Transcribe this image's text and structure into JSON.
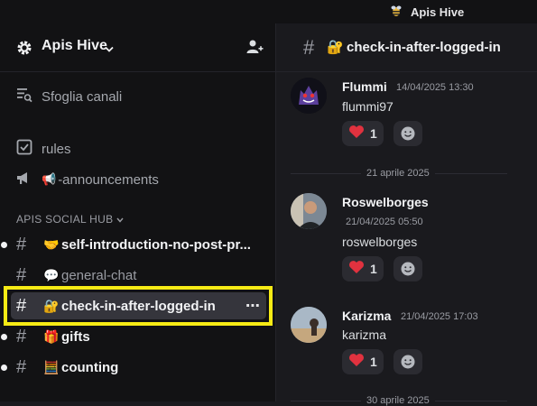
{
  "window": {
    "title": "Apis Hive",
    "title_icon": "bee-icon"
  },
  "sidebar": {
    "server_name": "Apis Hive",
    "browse_label": "Sfoglia canali",
    "top_channels": [
      {
        "label": "rules",
        "icon": "rules-checkbox-icon"
      },
      {
        "label": "-announcements",
        "icon": "megaphone-icon",
        "emoji": "📢"
      }
    ],
    "section_title": "APIS SOCIAL HUB",
    "channels": [
      {
        "emoji": "🤝",
        "label": "self-introduction-no-post-pr...",
        "unread": true
      },
      {
        "emoji": "💬",
        "label": "general-chat",
        "unread": false
      },
      {
        "emoji": "🔐",
        "label": "check-in-after-logged-in",
        "active": true,
        "more": "⋯"
      },
      {
        "emoji": "🎁",
        "label": "gifts",
        "unread": true
      },
      {
        "emoji": "🧮",
        "label": "counting",
        "unread": true
      }
    ]
  },
  "channel": {
    "emoji": "🔐",
    "name": "check-in-after-logged-in"
  },
  "messages": [
    {
      "author": "Flummi",
      "timestamp": "14/04/2025 13:30",
      "text": "flummi97",
      "reaction": {
        "emoji": "❤️",
        "count": "1"
      }
    },
    {
      "author": "Roswelborges",
      "timestamp": "21/04/2025 05:50",
      "text": "roswelborges",
      "reaction": {
        "emoji": "❤️",
        "count": "1"
      }
    },
    {
      "author": "Karizma",
      "timestamp": "21/04/2025 17:03",
      "text": "karizma",
      "reaction": {
        "emoji": "❤️",
        "count": "1"
      }
    }
  ],
  "date_dividers": [
    "21 aprile 2025",
    "30 aprile 2025"
  ],
  "colors": {
    "highlight": "#f7eb15",
    "background": "#1a1a1e",
    "sidebar": "#121214"
  }
}
